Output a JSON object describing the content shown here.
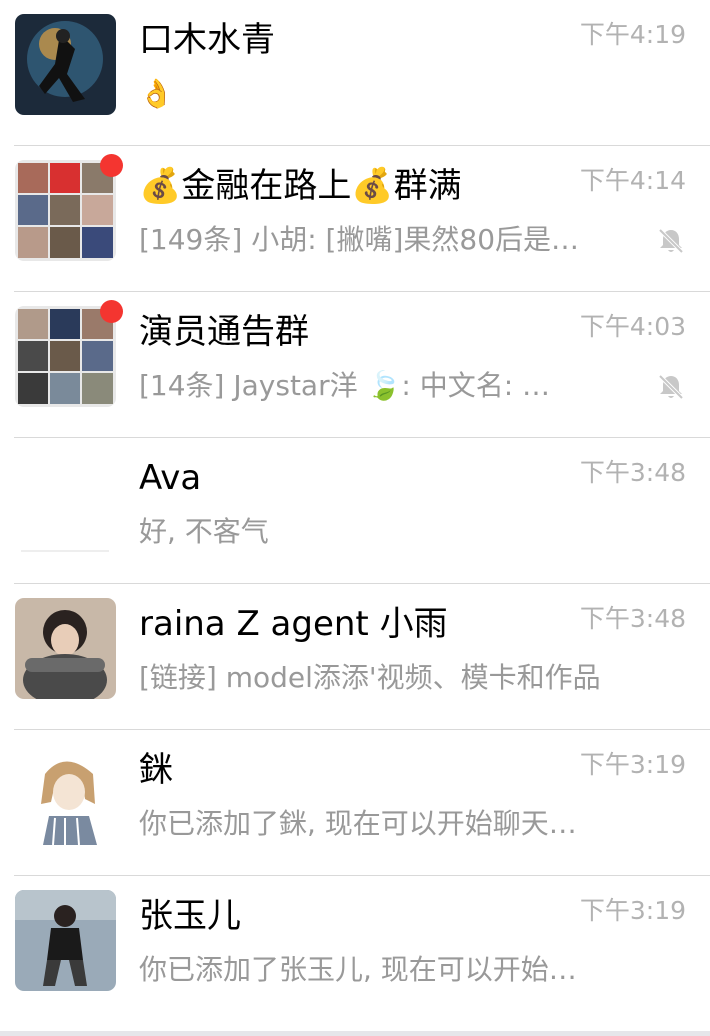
{
  "chats": [
    {
      "name": "口木水青",
      "preview": "👌",
      "time": "下午4:19",
      "unread": false,
      "muted": false
    },
    {
      "name": "💰金融在路上💰群满",
      "preview": "[149条] 小胡: [撇嘴]果然80后是…",
      "time": "下午4:14",
      "unread": true,
      "muted": true
    },
    {
      "name": "演员通告群",
      "preview": "[14条]   Jaystar洋 🍃: 中文名: …",
      "time": "下午4:03",
      "unread": true,
      "muted": true
    },
    {
      "name": "Ava",
      "preview": "好, 不客气",
      "time": "下午3:48",
      "unread": false,
      "muted": false
    },
    {
      "name": "raina Z agent 小雨",
      "preview": "[链接] model添添'视频、模卡和作品",
      "time": "下午3:48",
      "unread": false,
      "muted": false
    },
    {
      "name": "銤",
      "preview": "你已添加了銤, 现在可以开始聊天…",
      "time": "下午3:19",
      "unread": false,
      "muted": false
    },
    {
      "name": "张玉儿",
      "preview": "你已添加了张玉儿, 现在可以开始…",
      "time": "下午3:19",
      "unread": false,
      "muted": false
    }
  ],
  "colors": {
    "unread_dot": "#f43530",
    "separator": "#d9d9d9",
    "secondary_text": "#999999",
    "time_text": "#b2b2b2"
  },
  "icons": {
    "mute": "bell-slash-icon"
  }
}
